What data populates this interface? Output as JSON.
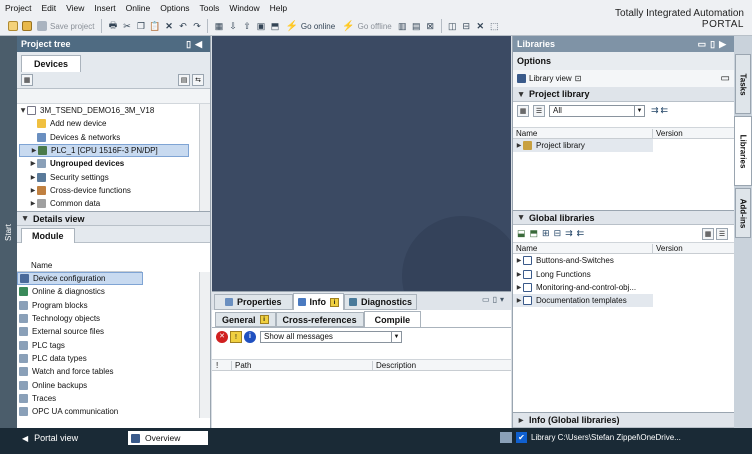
{
  "menu": [
    "Project",
    "Edit",
    "View",
    "Insert",
    "Online",
    "Options",
    "Tools",
    "Window",
    "Help"
  ],
  "toolbar": {
    "save_project": "Save project",
    "go_online": "Go online",
    "go_offline": "Go offline"
  },
  "brand": {
    "line1": "Totally Integrated Automation",
    "line2": "PORTAL"
  },
  "start_strip": "Start",
  "project_tree": {
    "title": "Project tree",
    "devices_tab": "Devices",
    "items": [
      {
        "label": "3M_TSEND_DEMO16_3M_V18"
      },
      {
        "label": "Add new device"
      },
      {
        "label": "Devices & networks"
      },
      {
        "label": "PLC_1 [CPU 1516F-3 PN/DP]"
      },
      {
        "label": "Ungrouped devices"
      },
      {
        "label": "Security settings"
      },
      {
        "label": "Cross-device functions"
      },
      {
        "label": "Common data"
      }
    ]
  },
  "details_view": {
    "title": "Details view",
    "tab": "Module",
    "col_name": "Name",
    "items": [
      "Device configuration",
      "Online & diagnostics",
      "Program blocks",
      "Technology objects",
      "External source files",
      "PLC tags",
      "PLC data types",
      "Watch and force tables",
      "Online backups",
      "Traces",
      "OPC UA communication"
    ]
  },
  "inspector": {
    "tabs": {
      "properties": "Properties",
      "info": "Info",
      "diagnostics": "Diagnostics"
    },
    "subtabs": {
      "general": "General",
      "crossref": "Cross-references",
      "compile": "Compile"
    },
    "filter": "Show all messages",
    "cols": {
      "mark": "!",
      "path": "Path",
      "description": "Description"
    }
  },
  "libraries": {
    "title": "Libraries",
    "options": "Options",
    "library_view": "Library view",
    "project_library": {
      "title": "Project library",
      "filter": "All",
      "col_name": "Name",
      "col_version": "Version",
      "items": [
        "Project library"
      ]
    },
    "global_libraries": {
      "title": "Global libraries",
      "col_name": "Name",
      "col_version": "Version",
      "items": [
        "Buttons-and-Switches",
        "Long Functions",
        "Monitoring-and-control-obj...",
        "Documentation templates"
      ]
    },
    "info_title": "Info (Global libraries)"
  },
  "side_tabs": [
    "Tasks",
    "Libraries",
    "Add-ins"
  ],
  "statusbar": {
    "portal_view": "Portal view",
    "overview": "Overview",
    "library_path": "Library C:\\Users\\Stefan Zippel\\OneDrive..."
  },
  "colors": {
    "header": "#4f6b82",
    "workarea": "#3b4a63",
    "statusbar": "#1a2a36"
  }
}
